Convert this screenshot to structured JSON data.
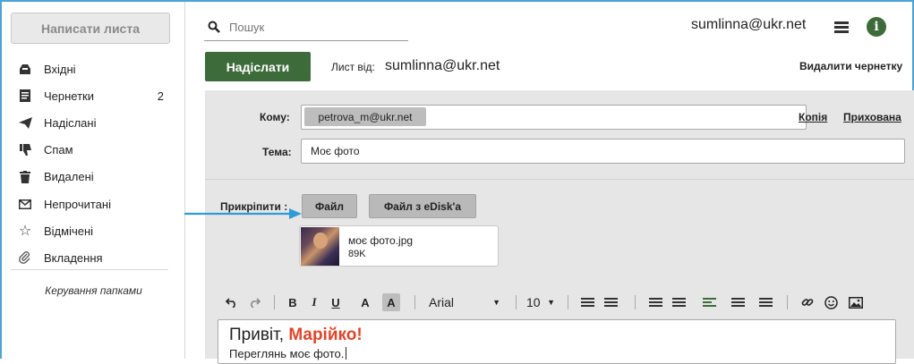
{
  "sidebar": {
    "compose_label": "Написати листа",
    "folders": [
      {
        "label": "Вхідні",
        "icon": "inbox-icon",
        "count": ""
      },
      {
        "label": "Чернетки",
        "icon": "drafts-icon",
        "count": "2"
      },
      {
        "label": "Надіслані",
        "icon": "sent-icon",
        "count": ""
      },
      {
        "label": "Спам",
        "icon": "spam-icon",
        "count": ""
      },
      {
        "label": "Видалені",
        "icon": "trash-icon",
        "count": ""
      },
      {
        "label": "Непрочитані",
        "icon": "unread-icon",
        "count": ""
      },
      {
        "label": "Відмічені",
        "icon": "star-icon",
        "count": ""
      },
      {
        "label": "Вкладення",
        "icon": "attachment-icon",
        "count": ""
      }
    ],
    "manage_folders": "Керування папками"
  },
  "header": {
    "search_placeholder": "Пошук",
    "user_email": "sumlinna@ukr.net"
  },
  "compose": {
    "send_label": "Надіслати",
    "from_label": "Лист від:",
    "from_value": "sumlinna@ukr.net",
    "delete_draft": "Видалити чернетку",
    "to_label": "Кому:",
    "to_recipient": "petrova_m@ukr.net",
    "cc_label": "Копія",
    "bcc_label": "Прихована",
    "subject_label": "Тема:",
    "subject_value": "Моє фото",
    "attach_label": "Прикріпити :",
    "attach_file": "Файл",
    "attach_edisk": "Файл з eDisk'a",
    "attachment": {
      "name": "моє фото.jpg",
      "size": "89K"
    }
  },
  "toolbar": {
    "font": "Arial",
    "size": "10",
    "bold": "B",
    "italic": "I",
    "underline": "U",
    "text_color": "A",
    "bg_color": "A"
  },
  "editor": {
    "greeting": "Привіт, ",
    "name": "Марійко!",
    "line2": "Переглянь моє фото."
  },
  "colors": {
    "accent_green": "#3d6b3a",
    "highlight_red": "#e0452b",
    "arrow_blue": "#2e9bd6"
  }
}
